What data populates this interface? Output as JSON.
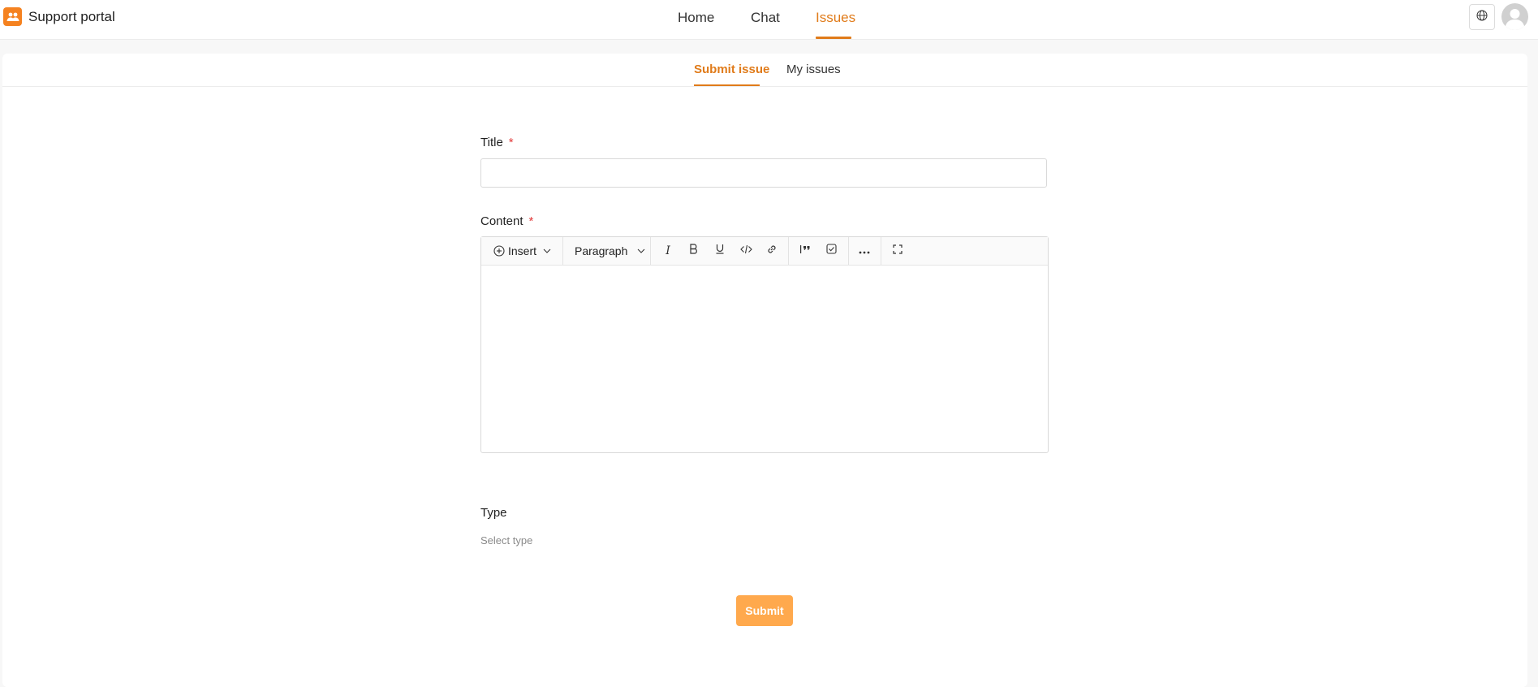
{
  "app": {
    "title": "Support portal",
    "accent": "#e07b1a",
    "logo_color": "#f58220"
  },
  "nav": {
    "items": [
      {
        "label": "Home"
      },
      {
        "label": "Chat"
      },
      {
        "label": "Issues"
      }
    ],
    "active": "Issues"
  },
  "header": {
    "language_icon": "globe-icon",
    "avatar_icon": "user-avatar-icon"
  },
  "subtabs": {
    "items": [
      {
        "label": "Submit issue"
      },
      {
        "label": "My issues"
      }
    ],
    "active": "Submit issue"
  },
  "form": {
    "title_label": "Title",
    "title_value": "",
    "content_label": "Content",
    "required_marker": "*",
    "type_label": "Type",
    "type_placeholder": "Select type",
    "submit_label": "Submit",
    "submit_color": "#ffa94d"
  },
  "editor": {
    "insert_label": "Insert",
    "block_style_label": "Paragraph",
    "content": "",
    "tools": [
      "italic-icon",
      "bold-icon",
      "underline-icon",
      "code-icon",
      "link-icon",
      "quote-icon",
      "checklist-icon",
      "more-icon",
      "fullscreen-icon"
    ]
  }
}
